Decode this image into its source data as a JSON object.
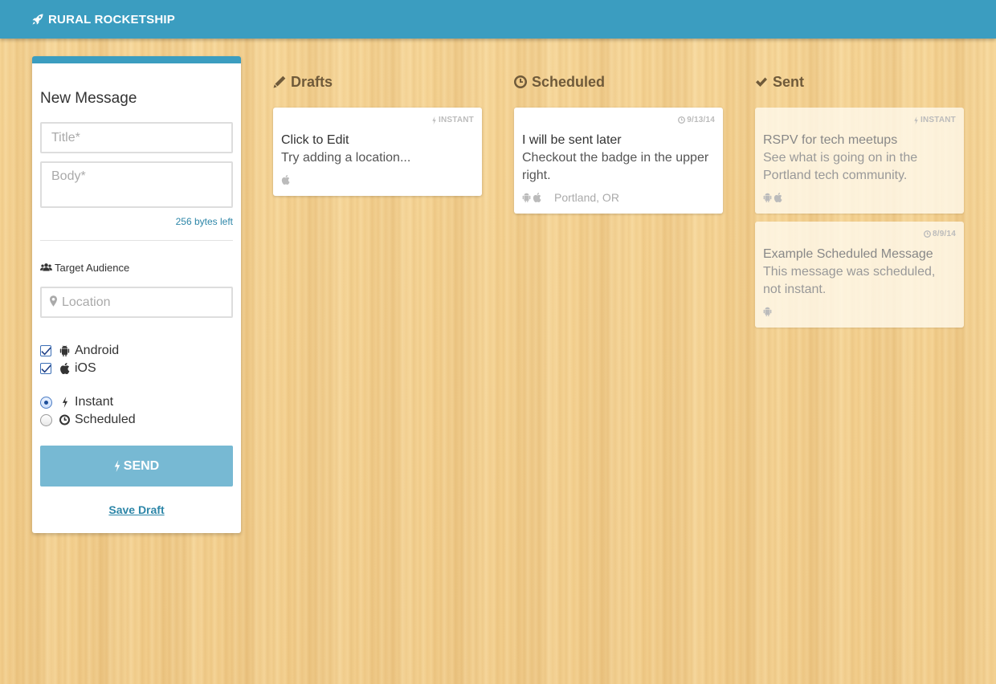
{
  "header": {
    "brand": "RURAL ROCKETSHIP"
  },
  "composer": {
    "title": "New Message",
    "title_placeholder": "Title*",
    "body_placeholder": "Body*",
    "bytes_left": "256 bytes left",
    "audience_label": "Target Audience",
    "location_placeholder": "Location",
    "platforms": [
      {
        "label": "Android",
        "checked": true
      },
      {
        "label": "iOS",
        "checked": true
      }
    ],
    "delivery": [
      {
        "label": "Instant",
        "selected": true
      },
      {
        "label": "Scheduled",
        "selected": false
      }
    ],
    "send_label": "SEND",
    "save_draft_label": "Save Draft"
  },
  "columns": {
    "drafts": {
      "heading": "Drafts",
      "cards": [
        {
          "badge": "INSTANT",
          "title": "Click to Edit",
          "body": "Try adding a location...",
          "platforms": [
            "ios"
          ],
          "location": ""
        }
      ]
    },
    "scheduled": {
      "heading": "Scheduled",
      "cards": [
        {
          "badge": "9/13/14",
          "title": "I will be sent later",
          "body": "Checkout the badge in the upper right.",
          "platforms": [
            "android",
            "ios"
          ],
          "location": "Portland, OR"
        }
      ]
    },
    "sent": {
      "heading": "Sent",
      "cards": [
        {
          "badge": "INSTANT",
          "title": "RSPV for tech meetups",
          "body": "See what is going on in the Portland tech community.",
          "platforms": [
            "android",
            "ios"
          ],
          "location": ""
        },
        {
          "badge": "8/9/14",
          "title": "Example Scheduled Message",
          "body": "This message was scheduled, not instant.",
          "platforms": [
            "android"
          ],
          "location": ""
        }
      ]
    }
  },
  "colors": {
    "accent": "#3b9dc0",
    "send_button": "#77b9d3",
    "link": "#2d86a8",
    "wood": "#f3cf8e",
    "column_heading": "#6f5a3a"
  },
  "icons": {
    "brand": "rocket-icon",
    "audience": "users-icon",
    "location": "map-marker-icon",
    "android": "android-icon",
    "ios": "apple-icon",
    "instant": "bolt-icon",
    "scheduled": "clock-icon",
    "drafts": "pencil-icon",
    "sent": "check-icon"
  }
}
